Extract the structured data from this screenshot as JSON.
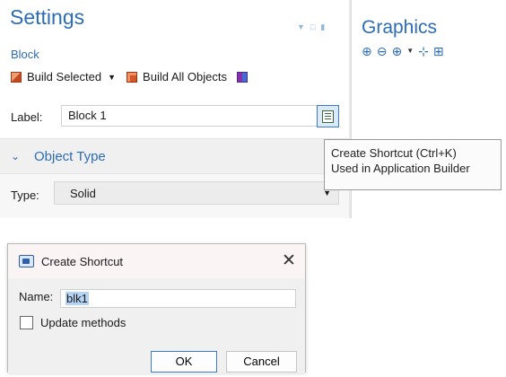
{
  "settings": {
    "title": "Settings",
    "subtitle": "Block",
    "toolbar": {
      "build_selected": "Build Selected",
      "build_all": "Build All Objects"
    },
    "label_field": {
      "label": "Label:",
      "value": "Block 1"
    },
    "section": {
      "title": "Object Type"
    },
    "type_field": {
      "label": "Type:",
      "value": "Solid"
    }
  },
  "graphics": {
    "title": "Graphics"
  },
  "tooltip": {
    "line1": "Create Shortcut (Ctrl+K)",
    "line2": "Used in Application Builder"
  },
  "dialog": {
    "title": "Create Shortcut",
    "close": "✕",
    "name_label": "Name:",
    "name_value": "blk1",
    "checkbox_label": "Update methods",
    "checkbox_checked": false,
    "ok": "OK",
    "cancel": "Cancel"
  },
  "colors": {
    "accent": "#2d6db5",
    "section_bg": "#f0f0f0",
    "dialog_title_bg": "#fbf4f5"
  }
}
